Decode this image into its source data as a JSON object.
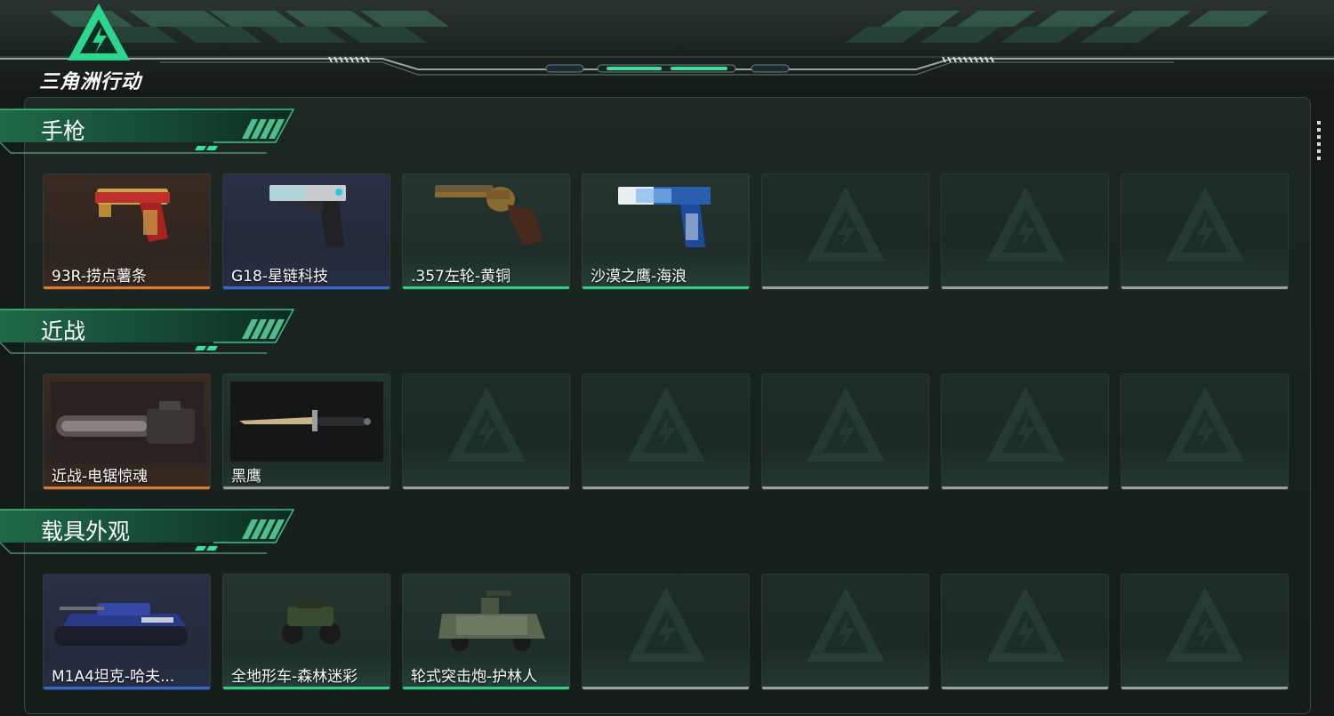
{
  "app": {
    "logo_text": "三角洲行动"
  },
  "colors": {
    "accent_green": "#2ee59d",
    "rarity_orange": "#e07a2a",
    "rarity_blue": "#3766d8",
    "rarity_green": "#2dd27f",
    "empty_gray": "#9aa19d"
  },
  "sections": [
    {
      "title": "手枪",
      "items": [
        {
          "label": "93R-捞点薯条",
          "rarity": "orange",
          "icon": "pistol-93r-red-gold"
        },
        {
          "label": "G18-星链科技",
          "rarity": "blue",
          "icon": "pistol-g18-silver"
        },
        {
          "label": ".357左轮-黄铜",
          "rarity": "green",
          "icon": "revolver-brass"
        },
        {
          "label": "沙漠之鹰-海浪",
          "rarity": "green",
          "icon": "pistol-desert-eagle-wave"
        },
        {
          "label": "",
          "rarity": "empty",
          "icon": "delta-placeholder"
        },
        {
          "label": "",
          "rarity": "empty",
          "icon": "delta-placeholder"
        },
        {
          "label": "",
          "rarity": "empty",
          "icon": "delta-placeholder"
        }
      ]
    },
    {
      "title": "近战",
      "items": [
        {
          "label": "近战-电锯惊魂",
          "rarity": "orange",
          "icon": "chainsaw"
        },
        {
          "label": "黑鹰",
          "rarity": "gray",
          "icon": "knife"
        },
        {
          "label": "",
          "rarity": "empty",
          "icon": "delta-placeholder"
        },
        {
          "label": "",
          "rarity": "empty",
          "icon": "delta-placeholder"
        },
        {
          "label": "",
          "rarity": "empty",
          "icon": "delta-placeholder"
        },
        {
          "label": "",
          "rarity": "empty",
          "icon": "delta-placeholder"
        },
        {
          "label": "",
          "rarity": "empty",
          "icon": "delta-placeholder"
        }
      ]
    },
    {
      "title": "载具外观",
      "items": [
        {
          "label": "M1A4坦克-哈夫...",
          "rarity": "blue",
          "icon": "tank"
        },
        {
          "label": "全地形车-森林迷彩",
          "rarity": "green",
          "icon": "atv"
        },
        {
          "label": "轮式突击炮-护林人",
          "rarity": "green",
          "icon": "armored-car"
        },
        {
          "label": "",
          "rarity": "empty",
          "icon": "delta-placeholder"
        },
        {
          "label": "",
          "rarity": "empty",
          "icon": "delta-placeholder"
        },
        {
          "label": "",
          "rarity": "empty",
          "icon": "delta-placeholder"
        },
        {
          "label": "",
          "rarity": "empty",
          "icon": "delta-placeholder"
        }
      ]
    }
  ]
}
